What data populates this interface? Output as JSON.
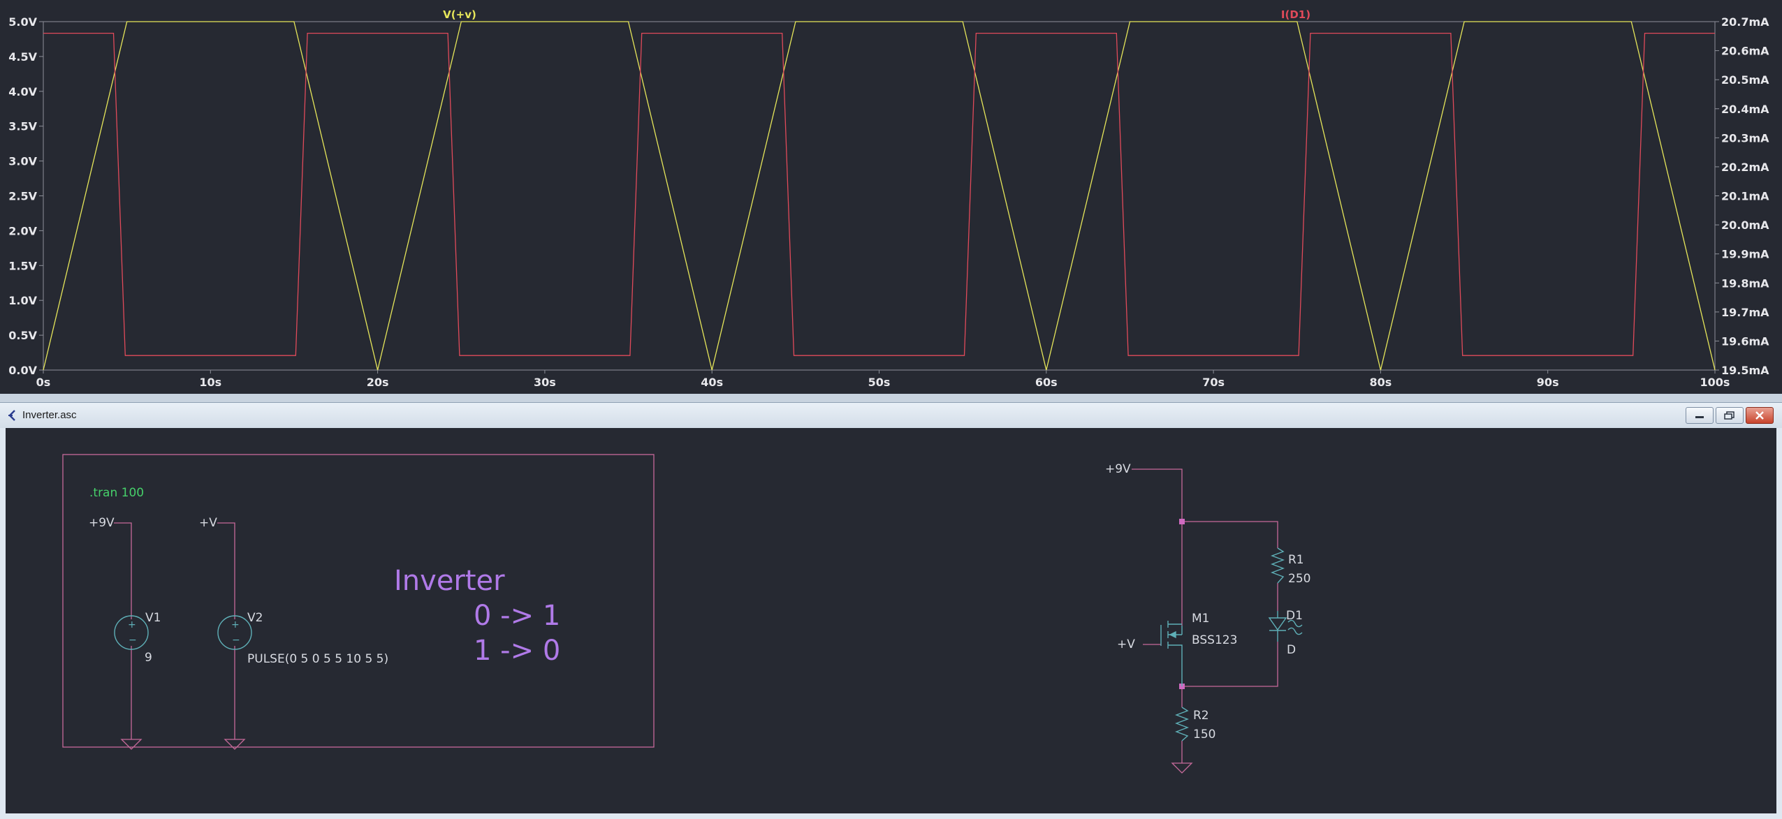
{
  "waveform": {
    "traces": [
      {
        "name": "V(+v)",
        "color": "#e6e65a"
      },
      {
        "name": "I(D1)",
        "color": "#e04a5a"
      }
    ],
    "left_axis_ticks": [
      "5.0V",
      "4.5V",
      "4.0V",
      "3.5V",
      "3.0V",
      "2.5V",
      "2.0V",
      "1.5V",
      "1.0V",
      "0.5V",
      "0.0V"
    ],
    "right_axis_ticks": [
      "20.7mA",
      "20.6mA",
      "20.5mA",
      "20.4mA",
      "20.3mA",
      "20.2mA",
      "20.1mA",
      "20.0mA",
      "19.9mA",
      "19.8mA",
      "19.7mA",
      "19.6mA",
      "19.5mA"
    ],
    "x_axis_ticks": [
      "0s",
      "10s",
      "20s",
      "30s",
      "40s",
      "50s",
      "60s",
      "70s",
      "80s",
      "90s",
      "100s"
    ]
  },
  "chart_data": {
    "type": "line",
    "x_unit": "s",
    "xlim": [
      0,
      100
    ],
    "ylim_left": [
      0.0,
      5.0
    ],
    "ylim_right": [
      19.5,
      20.7
    ],
    "series": [
      {
        "name": "V(+v)",
        "axis": "left",
        "x": [
          0,
          5,
          15,
          20,
          25,
          35,
          40,
          45,
          55,
          60,
          65,
          75,
          80,
          85,
          95,
          100
        ],
        "y": [
          0,
          5,
          5,
          0,
          5,
          5,
          0,
          5,
          5,
          0,
          5,
          5,
          0,
          5,
          5,
          0
        ]
      },
      {
        "name": "I(D1)",
        "axis": "right",
        "x": [
          0,
          4.2,
          4.9,
          15.1,
          15.8,
          24.2,
          24.9,
          35.1,
          35.8,
          44.2,
          44.9,
          55.1,
          55.8,
          64.2,
          64.9,
          75.1,
          75.8,
          84.2,
          84.9,
          95.1,
          95.8,
          100
        ],
        "y": [
          20.66,
          20.66,
          19.55,
          19.55,
          20.66,
          20.66,
          19.55,
          19.55,
          20.66,
          20.66,
          19.55,
          19.55,
          20.66,
          20.66,
          19.55,
          19.55,
          20.66,
          20.66,
          19.55,
          19.55,
          20.66,
          20.66
        ]
      }
    ],
    "grid": false
  },
  "schematic_window": {
    "title": "Inverter.asc",
    "directive": ".tran 100",
    "comment_title": "Inverter",
    "comment_line1": "0 -> 1",
    "comment_line2": "1 -> 0",
    "sources": [
      {
        "net": "+9V",
        "name": "V1",
        "value": "9"
      },
      {
        "net": "+V",
        "name": "V2",
        "value": "PULSE(0 5 0 5 5 10 5 5)"
      }
    ],
    "circuit": {
      "supply_net": "+9V",
      "gate_net": "+V",
      "mosfet_name": "M1",
      "mosfet_model": "BSS123",
      "r1_name": "R1",
      "r1_value": "250",
      "diode_name": "D1",
      "diode_model": "D",
      "r2_name": "R2",
      "r2_value": "150"
    }
  }
}
